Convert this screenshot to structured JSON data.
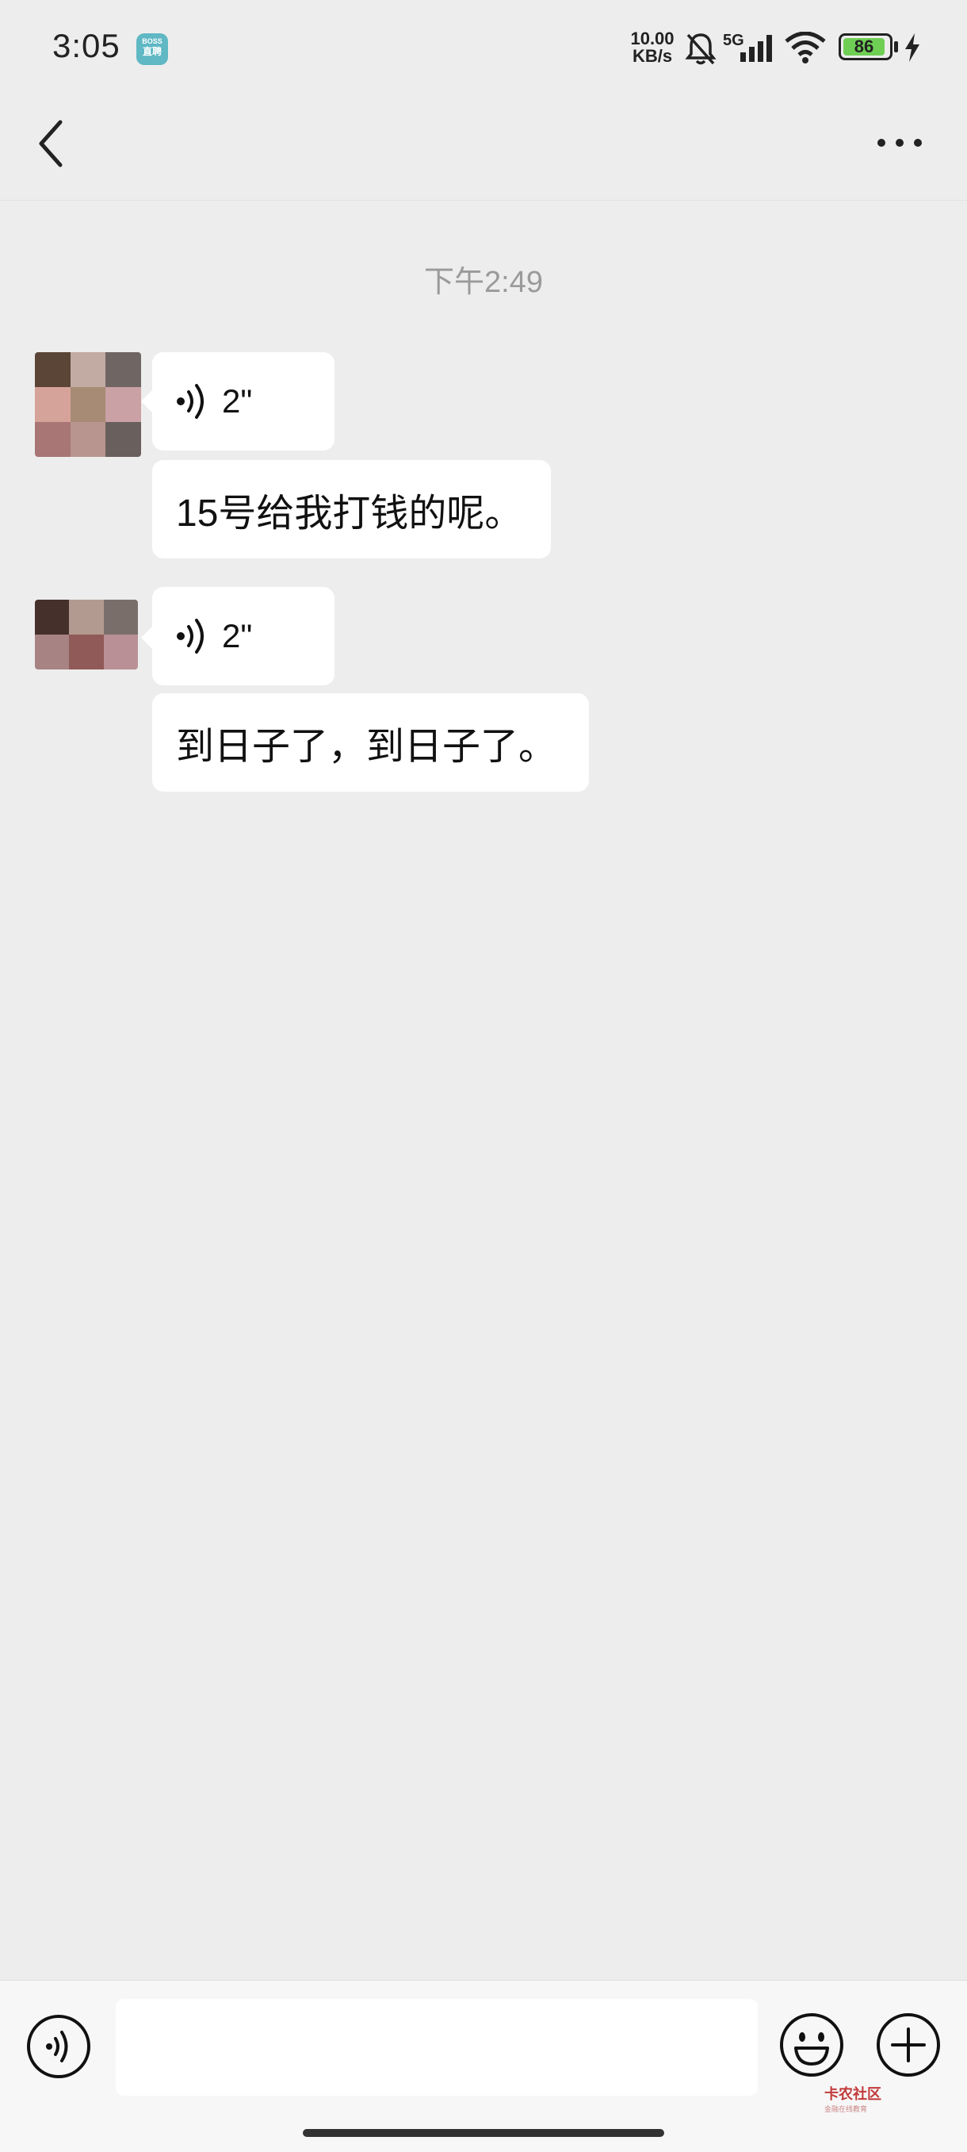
{
  "status_bar": {
    "time": "3:05",
    "app_badge_top": "BOSS",
    "app_badge_bottom": "直聘",
    "net_speed_value": "10.00",
    "net_speed_unit": "KB/s",
    "network": "5G",
    "battery": "86"
  },
  "chat": {
    "timestamp": "下午2:49",
    "groups": [
      {
        "voice_duration": "2\"",
        "text": "15号给我打钱的呢。",
        "avatar_colors": [
          "#5b4537",
          "#c2aba3",
          "#6f6664",
          "#d6a39a",
          "#a78b75",
          "#caa1a5",
          "#a87675",
          "#b8958e",
          "#69605d"
        ]
      },
      {
        "voice_duration": "2\"",
        "text": "到日子了，到日子了。",
        "avatar_colors": [
          "#45302b",
          "#b39a91",
          "#7a6e6b",
          "#a78384",
          "#8f5a58",
          "#b99095"
        ]
      }
    ]
  },
  "watermark": {
    "text": "卡农社区",
    "sub": "金融在线教育"
  },
  "colors": {
    "background": "#ededed",
    "bubble": "#ffffff",
    "battery_fill": "#6fcf55"
  },
  "icons": [
    "back-icon",
    "more-icon",
    "voice-wave-icon",
    "keyboard-voice-icon",
    "emoji-icon",
    "plus-icon"
  ]
}
